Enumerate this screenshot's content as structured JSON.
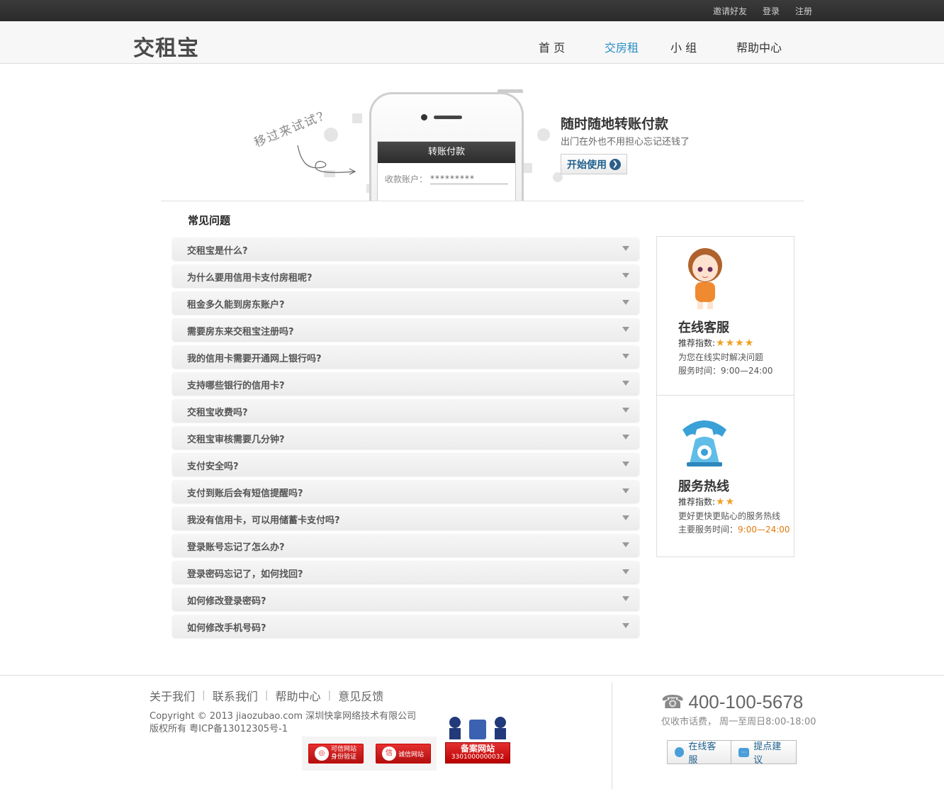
{
  "topbar": {
    "links": [
      "邀请好友",
      "登录",
      "注册"
    ]
  },
  "header": {
    "logo": "交租宝",
    "nav": [
      {
        "label": "首 页",
        "active": false
      },
      {
        "label": "交房租",
        "active": true
      },
      {
        "label": "小 组",
        "active": false
      },
      {
        "label": "帮助中心",
        "active": false
      }
    ]
  },
  "banner": {
    "scribble": "移过来试试?",
    "phone_screen_title": "转账付款",
    "phone_field_label": "收款账户：",
    "phone_field_value": "*********",
    "title": "随时随地转账付款",
    "subtitle": "出门在外也不用担心忘记还钱了",
    "button": "开始使用"
  },
  "faq": {
    "title": "常见问题",
    "items": [
      "交租宝是什么?",
      "为什么要用信用卡支付房租呢?",
      "租金多久能到房东账户?",
      "需要房东来交租宝注册吗?",
      "我的信用卡需要开通网上银行吗?",
      "支持哪些银行的信用卡?",
      "交租宝收费吗?",
      "交租宝审核需要几分钟?",
      "支付安全吗?",
      "支付到账后会有短信提醒吗?",
      "我没有信用卡，可以用储蓄卡支付吗?",
      "登录账号忘记了怎么办?",
      "登录密码忘记了，如何找回?",
      "如何修改登录密码?",
      "如何修改手机号码?"
    ]
  },
  "side": {
    "online": {
      "title": "在线客服",
      "rec_label": "推荐指数:",
      "stars": 4,
      "line1": "为您在线实时解决问题",
      "line2_label": "服务时间：",
      "line2_value": "9:00—24:00"
    },
    "hotline": {
      "title": "服务热线",
      "rec_label": "推荐指数:",
      "stars": 2,
      "line1": "更好更快更贴心的服务热线",
      "line2_label": "主要服务时间：",
      "line2_value": "9:00—24:00"
    }
  },
  "footer": {
    "links": [
      "关于我们",
      "联系我们",
      "帮助中心",
      "意见反馈"
    ],
    "copyright": "Copyright © 2013 jiaozubao.com 深圳快拿网络技术有限公司",
    "icp": "版权所有  粤ICP备13012305号-1",
    "badge1": "可信网站",
    "badge1_sub": "身份验证",
    "badge2": "诚信网站",
    "beian_title": "备案网站",
    "beian_no": "3301000000032",
    "phone": "400-100-5678",
    "hours": "仅收市话费， 周一至周日8:00-18:00",
    "btn_online": "在线客服",
    "btn_suggest": "提点建议"
  },
  "colors": {
    "accent": "#2a8fc6",
    "star": "#f0a020",
    "highlight": "#e07a10"
  }
}
